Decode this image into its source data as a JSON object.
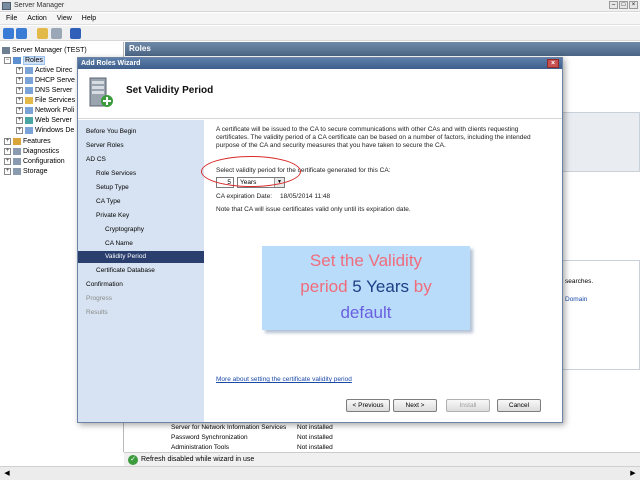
{
  "window": {
    "title": "Server Manager"
  },
  "menu": [
    "File",
    "Action",
    "View",
    "Help"
  ],
  "tree": {
    "root": "Server Manager (TEST)",
    "roles": "Roles",
    "role_items": [
      "Active Direc",
      "DHCP Serve",
      "DNS Server",
      "File Services",
      "Network Poli",
      "Web Server",
      "Windows De"
    ],
    "features": "Features",
    "diagnostics": "Diagnostics",
    "configuration": "Configuration",
    "storage": "Storage"
  },
  "right_pane": {
    "header": "Roles",
    "bg_text_searches": "searches.",
    "bg_link_domain": "Domain",
    "rows": [
      {
        "name": "Server for Network Information Services",
        "status": "Not installed"
      },
      {
        "name": "Password Synchronization",
        "status": "Not installed"
      },
      {
        "name": "Administration Tools",
        "status": "Not installed"
      }
    ]
  },
  "status_bar": {
    "text": "Refresh disabled while wizard in use"
  },
  "dialog": {
    "title": "Add Roles Wizard",
    "heading": "Set Validity Period",
    "nav": [
      {
        "label": "Before You Begin",
        "indent": 0,
        "state": "normal"
      },
      {
        "label": "Server Roles",
        "indent": 0,
        "state": "normal"
      },
      {
        "label": "AD CS",
        "indent": 0,
        "state": "normal"
      },
      {
        "label": "Role Services",
        "indent": 1,
        "state": "normal"
      },
      {
        "label": "Setup Type",
        "indent": 1,
        "state": "normal"
      },
      {
        "label": "CA Type",
        "indent": 1,
        "state": "normal"
      },
      {
        "label": "Private Key",
        "indent": 1,
        "state": "normal"
      },
      {
        "label": "Cryptography",
        "indent": 2,
        "state": "normal"
      },
      {
        "label": "CA Name",
        "indent": 2,
        "state": "normal"
      },
      {
        "label": "Validity Period",
        "indent": 2,
        "state": "current"
      },
      {
        "label": "Certificate Database",
        "indent": 1,
        "state": "normal"
      },
      {
        "label": "Confirmation",
        "indent": 0,
        "state": "normal"
      },
      {
        "label": "Progress",
        "indent": 0,
        "state": "disabled"
      },
      {
        "label": "Results",
        "indent": 0,
        "state": "disabled"
      }
    ],
    "description": "A certificate will be issued to the CA to secure communications with other CAs and with clients requesting certificates. The validity period of a CA certificate can be based on a number of factors, including the intended purpose of the CA and security measures that you have taken to secure the CA.",
    "select_label": "Select validity period for the certificate generated for this CA:",
    "validity_value": "5",
    "validity_unit": "Years",
    "expiration_label": "CA expiration Date:",
    "expiration_date": "18/05/2014 11:48",
    "note": "Note that CA will issue certificates valid only until its expiration date.",
    "more_link": "More about setting the certificate validity period",
    "buttons": {
      "previous": "< Previous",
      "next": "Next >",
      "install": "Install",
      "cancel": "Cancel"
    }
  },
  "callout": {
    "part1": "Set the Validity",
    "part2": "period",
    "part3": "5 Years",
    "part4": "by",
    "part5": "default"
  }
}
